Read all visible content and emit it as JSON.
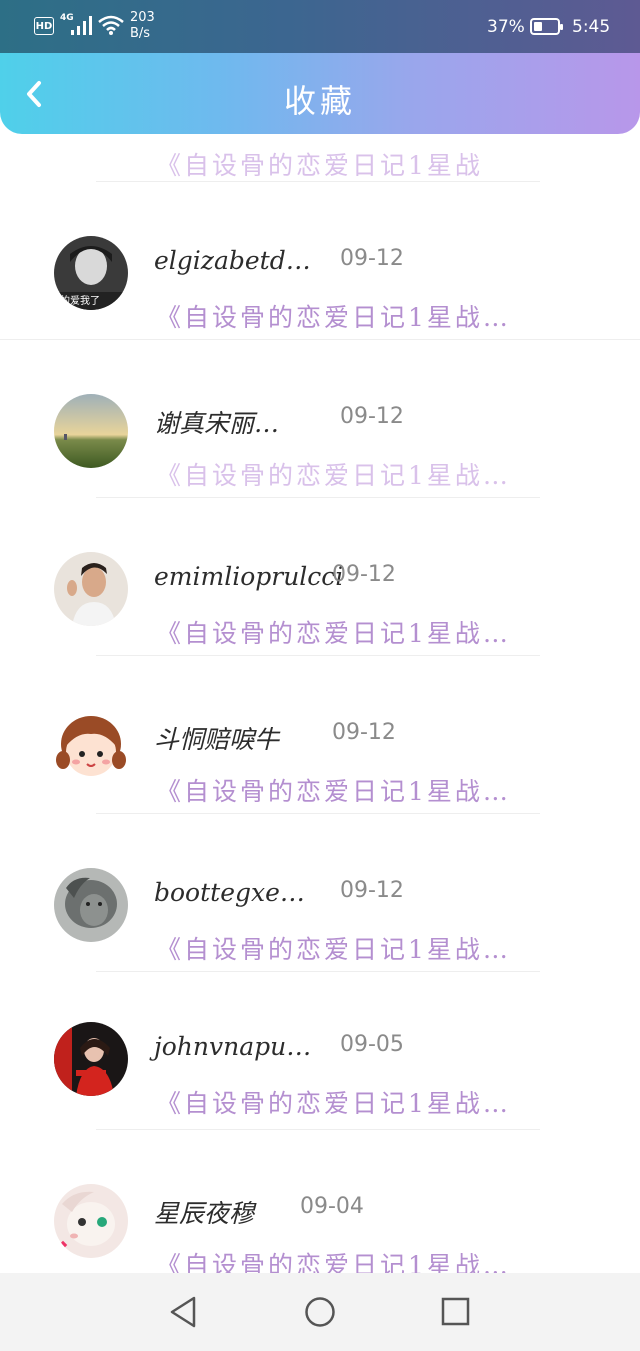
{
  "status_bar": {
    "hd": "HD",
    "network": "4G",
    "speed_value": "203",
    "speed_unit": "B/s",
    "battery_pct": "37%",
    "battery_level": 0.37,
    "time": "5:45"
  },
  "header": {
    "title": "收藏",
    "back_icon": "chevron-left-icon"
  },
  "partial_row": {
    "desc": "《自设骨的恋爱日记1星战"
  },
  "items": [
    {
      "name": "elgizabetd…",
      "date": "09-12",
      "desc": "《自设骨的恋爱日记1星战…",
      "avatar": "photo-avatar-boy"
    },
    {
      "name": "谢真宋丽…",
      "date": "09-12",
      "desc": "《自设骨的恋爱日记1星战…",
      "avatar": "landscape-avatar"
    },
    {
      "name": "emimlioprulcci",
      "date": "09-12",
      "desc": "《自设骨的恋爱日记1星战…",
      "avatar": "photo-avatar-man"
    },
    {
      "name": "斗恫赔唳牛",
      "date": "09-12",
      "desc": "《自设骨的恋爱日记1星战…",
      "avatar": "cartoon-girl-avatar"
    },
    {
      "name": "boottegxe…",
      "date": "09-12",
      "desc": "《自设骨的恋爱日记1星战…",
      "avatar": "lion-avatar"
    },
    {
      "name": "johnvnapu…",
      "date": "09-05",
      "desc": "《自设骨的恋爱日记1星战…",
      "avatar": "red-dress-avatar"
    },
    {
      "name": "星辰夜穆",
      "date": "09-04",
      "desc": "《自设骨的恋爱日记1星战…",
      "avatar": "anime-avatar"
    }
  ],
  "nav": {
    "back": "triangle-back-icon",
    "home": "circle-home-icon",
    "recents": "square-recents-icon"
  },
  "colors": {
    "header_gradient_start": "#4fd0ea",
    "header_gradient_end": "#b897ea",
    "desc_purple": "#b48fd0"
  }
}
